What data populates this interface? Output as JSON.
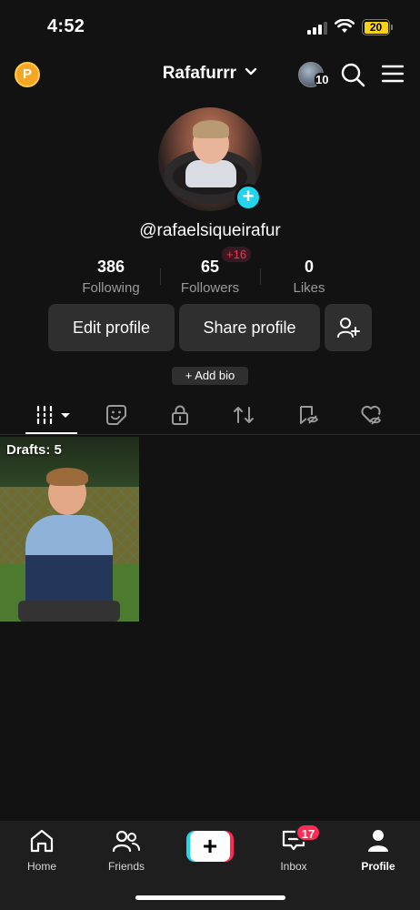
{
  "status_bar": {
    "time": "4:52",
    "battery": "20"
  },
  "header": {
    "coin_icon": "P",
    "username": "Rafafurrr",
    "story_count": "10"
  },
  "profile": {
    "handle": "@rafaelsiqueirafur",
    "stats": {
      "following": {
        "value": "386",
        "label": "Following"
      },
      "followers": {
        "value": "65",
        "label": "Followers",
        "new": "+16"
      },
      "likes": {
        "value": "0",
        "label": "Likes"
      }
    },
    "buttons": {
      "edit": "Edit profile",
      "share": "Share profile"
    },
    "add_bio": "+ Add bio"
  },
  "tabs": [
    "videos-grid",
    "stickers",
    "private",
    "reposts",
    "favorites",
    "liked"
  ],
  "grid": {
    "drafts_label": "Drafts: 5"
  },
  "bottom_nav": {
    "home": "Home",
    "friends": "Friends",
    "inbox": "Inbox",
    "inbox_badge": "17",
    "profile": "Profile"
  },
  "colors": {
    "background": "#121212",
    "accent_cyan": "#20d5ec",
    "accent_red": "#fe2c55",
    "button_bg": "#2f2f2f"
  }
}
